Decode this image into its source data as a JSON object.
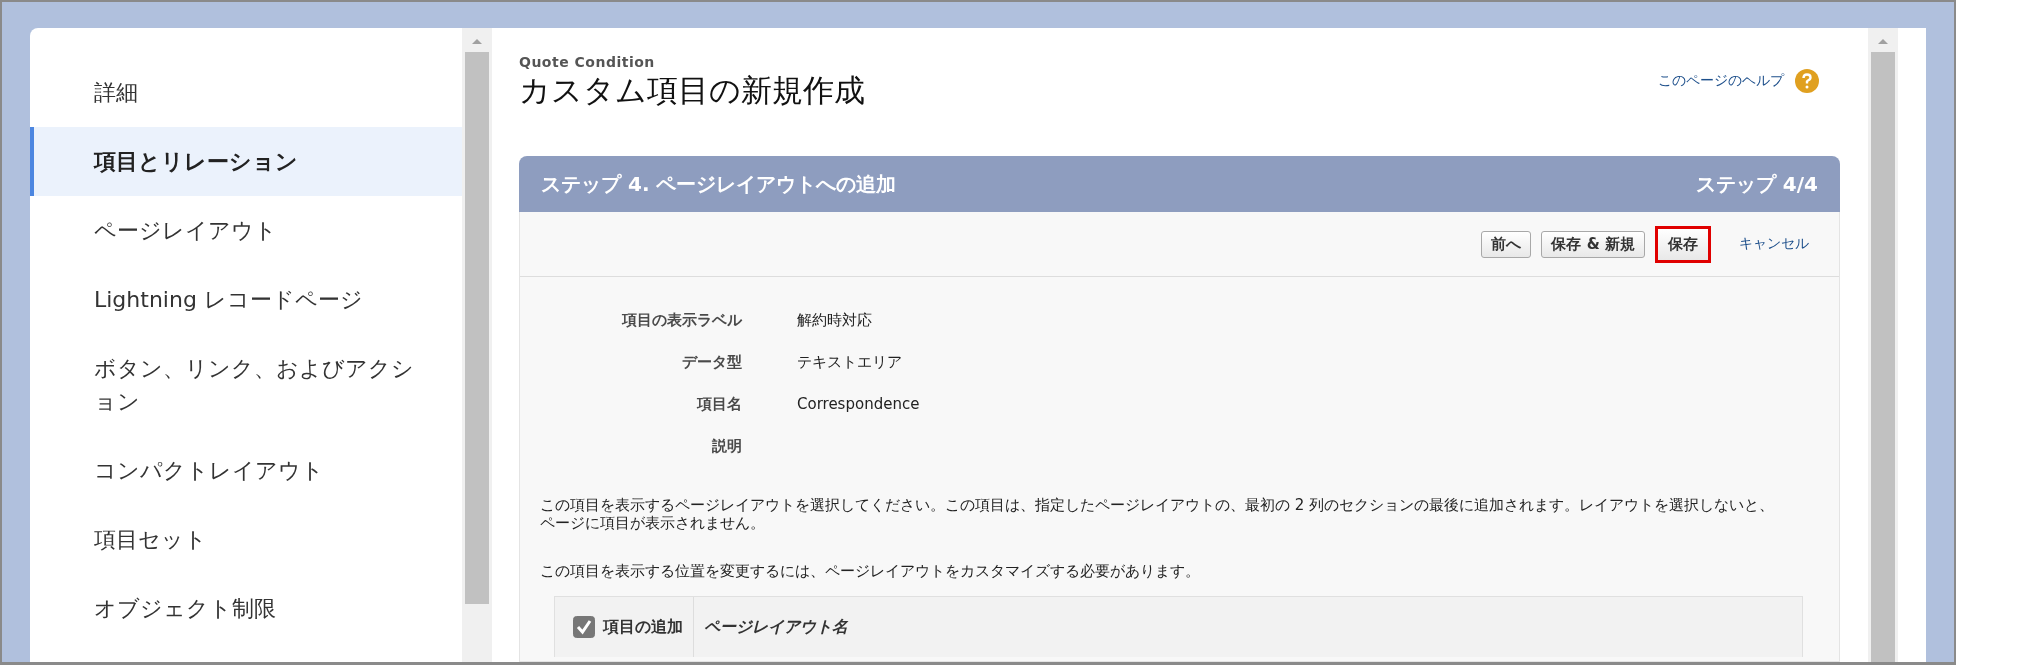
{
  "sidebar": {
    "items": [
      {
        "label": "詳細",
        "selected": false
      },
      {
        "label": "項目とリレーション",
        "selected": true
      },
      {
        "label": "ページレイアウト",
        "selected": false
      },
      {
        "label": "Lightning レコードページ",
        "selected": false
      },
      {
        "label": "ボタン、リンク、およびアクション",
        "selected": false
      },
      {
        "label": "コンパクトレイアウト",
        "selected": false
      },
      {
        "label": "項目セット",
        "selected": false
      },
      {
        "label": "オブジェクト制限",
        "selected": false
      }
    ]
  },
  "header": {
    "object_name": "Quote Condition",
    "title": "カスタム項目の新規作成",
    "help_link": "このページのヘルプ"
  },
  "step": {
    "title": "ステップ 4. ページレイアウトへの追加",
    "counter": "ステップ 4/4",
    "buttons": [
      {
        "label": "前へ",
        "kind": "button",
        "highlighted": false
      },
      {
        "label": "保存 & 新規",
        "kind": "button",
        "highlighted": false
      },
      {
        "label": "保存",
        "kind": "button",
        "highlighted": true
      },
      {
        "label": "キャンセル",
        "kind": "link"
      }
    ]
  },
  "details": [
    {
      "label": "項目の表示ラベル",
      "value": "解約時対応"
    },
    {
      "label": "データ型",
      "value": "テキストエリア"
    },
    {
      "label": "項目名",
      "value": "Correspondence"
    },
    {
      "label": "説明"
    }
  ],
  "instructions": [
    "この項目を表示するページレイアウトを選択してください。この項目は、指定したページレイアウトの、最初の 2 列のセクションの最後に追加されます。レイアウトを選択しないと、ページに項目が表示されません。",
    "この項目を表示する位置を変更するには、ページレイアウトをカスタマイズする必要があります。"
  ],
  "layout_table": {
    "columns": [
      {
        "label": "項目の追加",
        "checked": true
      },
      {
        "label": "ページレイアウト名"
      }
    ]
  }
}
